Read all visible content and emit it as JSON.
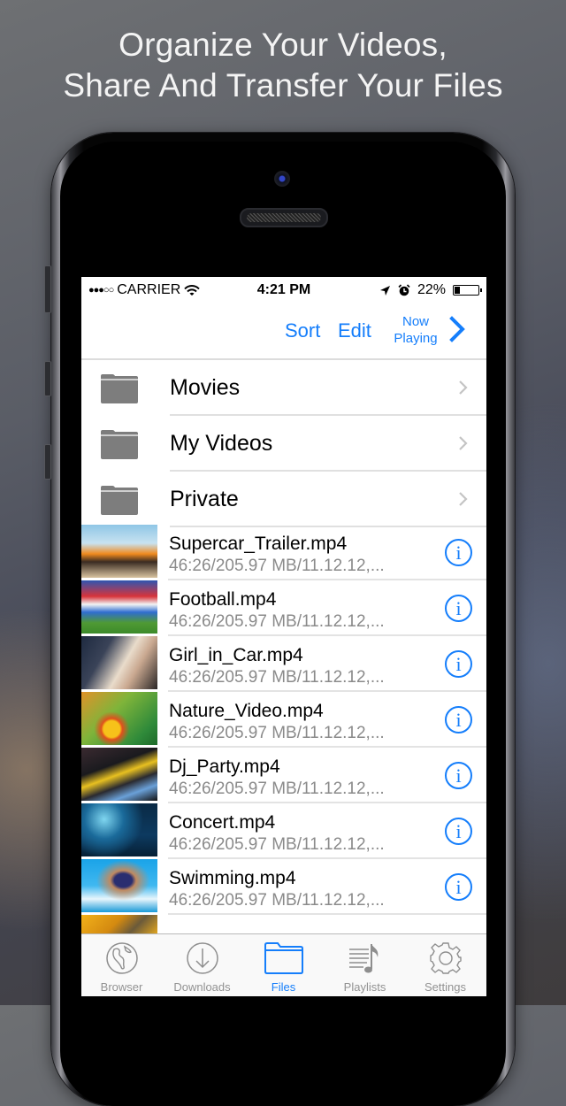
{
  "headline": {
    "line1": "Organize Your Videos,",
    "line2": "Share And Transfer Your Files"
  },
  "status_bar": {
    "signal": "●●●○○",
    "carrier": "CARRIER",
    "time": "4:21 PM",
    "battery_percent": "22%",
    "battery_level": 0.22
  },
  "nav": {
    "sort_label": "Sort",
    "edit_label": "Edit",
    "now_playing_line1": "Now",
    "now_playing_line2": "Playing"
  },
  "folders": [
    {
      "label": "Movies"
    },
    {
      "label": "My Videos"
    },
    {
      "label": "Private"
    }
  ],
  "files": [
    {
      "name": "Supercar_Trailer.mp4",
      "meta": "46:26/205.97 MB/11.12.12,...",
      "thumb": "car"
    },
    {
      "name": "Football.mp4",
      "meta": "46:26/205.97 MB/11.12.12,...",
      "thumb": "football"
    },
    {
      "name": "Girl_in_Car.mp4",
      "meta": "46:26/205.97 MB/11.12.12,...",
      "thumb": "girl"
    },
    {
      "name": "Nature_Video.mp4",
      "meta": "46:26/205.97 MB/11.12.12,...",
      "thumb": "nature"
    },
    {
      "name": "Dj_Party.mp4",
      "meta": "46:26/205.97 MB/11.12.12,...",
      "thumb": "dj"
    },
    {
      "name": "Concert.mp4",
      "meta": "46:26/205.97 MB/11.12.12,...",
      "thumb": "concert"
    },
    {
      "name": "Swimming.mp4",
      "meta": "46:26/205.97 MB/11.12.12,...",
      "thumb": "swim"
    }
  ],
  "info_glyph": "i",
  "tabs": [
    {
      "label": "Browser",
      "icon": "globe-icon"
    },
    {
      "label": "Downloads",
      "icon": "download-icon"
    },
    {
      "label": "Files",
      "icon": "folder-icon",
      "active": true
    },
    {
      "label": "Playlists",
      "icon": "playlist-icon"
    },
    {
      "label": "Settings",
      "icon": "gear-icon"
    }
  ],
  "colors": {
    "accent": "#157efb",
    "inactive_tab": "#929292",
    "folder_gray": "#7d7d7d"
  }
}
